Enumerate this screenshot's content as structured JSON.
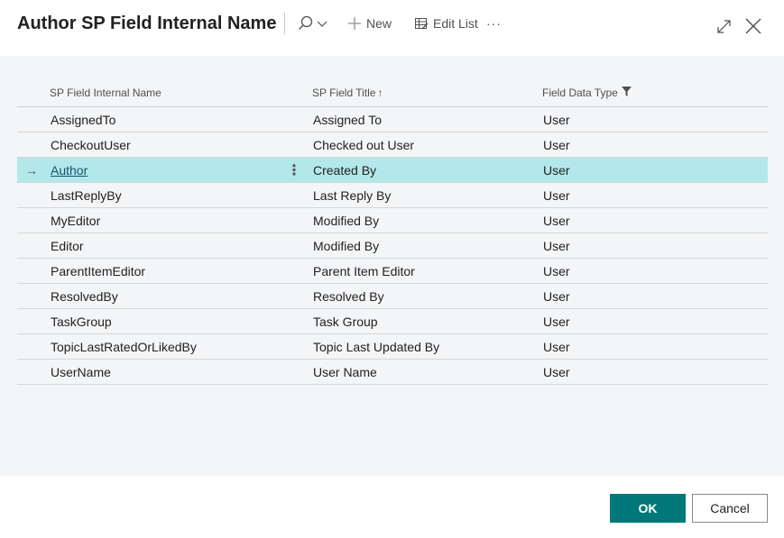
{
  "dialog": {
    "title": "Author SP Field Internal Name"
  },
  "toolbar": {
    "new_label": "New",
    "edit_list_label": "Edit List",
    "more_label": "···",
    "search_icon": "search-icon",
    "expand_icon": "expand-icon",
    "close_icon": "close-icon"
  },
  "table": {
    "columns": [
      {
        "label": "SP Field Internal Name"
      },
      {
        "label": "SP Field Title",
        "sort_indicator": "↑"
      },
      {
        "label": "Field Data Type",
        "filter_icon": "filter-icon"
      }
    ],
    "rows": [
      {
        "internal_name": "AssignedTo",
        "title": "Assigned To",
        "type": "User"
      },
      {
        "internal_name": "CheckoutUser",
        "title": "Checked out User",
        "type": "User"
      },
      {
        "internal_name": "Author",
        "title": "Created By",
        "type": "User",
        "selected": true
      },
      {
        "internal_name": "LastReplyBy",
        "title": "Last Reply By",
        "type": "User"
      },
      {
        "internal_name": "MyEditor",
        "title": "Modified By",
        "type": "User"
      },
      {
        "internal_name": "Editor",
        "title": "Modified By",
        "type": "User"
      },
      {
        "internal_name": "ParentItemEditor",
        "title": "Parent Item Editor",
        "type": "User"
      },
      {
        "internal_name": "ResolvedBy",
        "title": "Resolved By",
        "type": "User"
      },
      {
        "internal_name": "TaskGroup",
        "title": "Task Group",
        "type": "User"
      },
      {
        "internal_name": "TopicLastRatedOrLikedBy",
        "title": "Topic Last Updated By",
        "type": "User"
      },
      {
        "internal_name": "UserName",
        "title": "User Name",
        "type": "User"
      }
    ],
    "selected_row_arrow": "→",
    "row_menu_glyph": "⋮"
  },
  "footer": {
    "ok_label": "OK",
    "cancel_label": "Cancel"
  },
  "colors": {
    "accent": "#00787a",
    "selected_row": "#b2e8ea",
    "content_bg": "#f4f5f7"
  }
}
